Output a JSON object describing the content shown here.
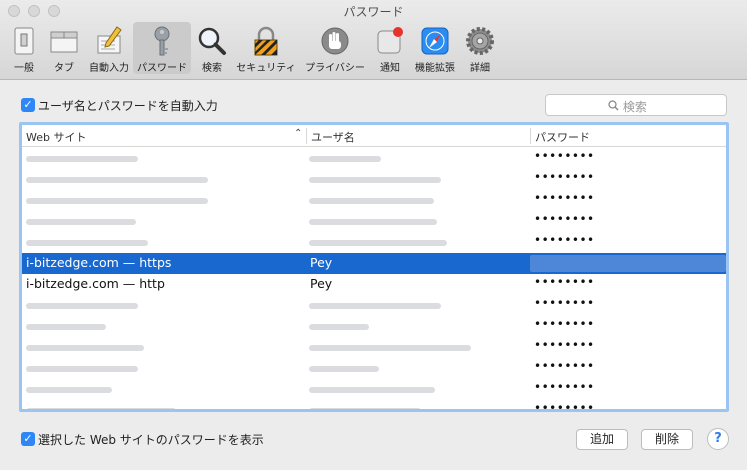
{
  "window": {
    "title": "パスワード"
  },
  "toolbar": {
    "items": [
      {
        "label": "一般",
        "icon": "general-icon"
      },
      {
        "label": "タブ",
        "icon": "tabs-icon"
      },
      {
        "label": "自動入力",
        "icon": "autofill-icon"
      },
      {
        "label": "パスワード",
        "icon": "key-icon",
        "selected": true
      },
      {
        "label": "検索",
        "icon": "search-icon"
      },
      {
        "label": "セキュリティ",
        "icon": "lock-icon"
      },
      {
        "label": "プライバシー",
        "icon": "hand-icon"
      },
      {
        "label": "通知",
        "icon": "notifications-icon"
      },
      {
        "label": "機能拡張",
        "icon": "extensions-icon"
      },
      {
        "label": "詳細",
        "icon": "gear-icon"
      }
    ]
  },
  "autofill": {
    "label": "ユーザ名とパスワードを自動入力",
    "checked": true
  },
  "search": {
    "placeholder": "検索"
  },
  "table": {
    "headers": {
      "site": "Web サイト",
      "user": "ユーザ名",
      "password": "パスワード"
    },
    "rows": [
      {
        "site": "",
        "user": "",
        "password": "••••••••"
      },
      {
        "site": "",
        "user": "",
        "password": "••••••••"
      },
      {
        "site": "",
        "user": "",
        "password": "••••••••"
      },
      {
        "site": "",
        "user": "",
        "password": "••••••••"
      },
      {
        "site": "",
        "user": "",
        "password": "••••••••"
      },
      {
        "site": "i-bitzedge.com — https",
        "user": "Pey",
        "password": "",
        "selected": true
      },
      {
        "site": "i-bitzedge.com — http",
        "user": "Pey",
        "password": "••••••••"
      },
      {
        "site": "",
        "user": "",
        "password": "••••••••"
      },
      {
        "site": "",
        "user": "",
        "password": "••••••••"
      },
      {
        "site": "",
        "user": "",
        "password": "••••••••"
      },
      {
        "site": "",
        "user": "",
        "password": "••••••••"
      },
      {
        "site": "",
        "user": "",
        "password": "••••••••"
      },
      {
        "site": "",
        "user": "",
        "password": "••••••••"
      }
    ]
  },
  "show_password": {
    "label": "選択した Web サイトのパスワードを表示",
    "checked": true
  },
  "buttons": {
    "add": "追加",
    "remove": "削除",
    "help": "?"
  },
  "colors": {
    "selection": "#1868cf",
    "accent": "#2f86f6",
    "focus_ring": "#9cc4f3"
  }
}
